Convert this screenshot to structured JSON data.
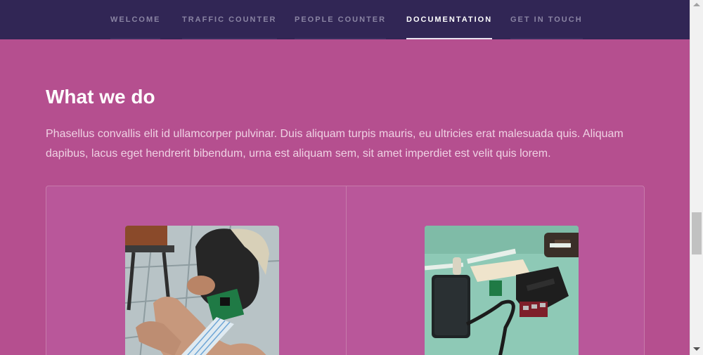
{
  "nav": {
    "items": [
      {
        "label": "WELCOME",
        "active": false
      },
      {
        "label": "TRAFFIC COUNTER",
        "active": false
      },
      {
        "label": "PEOPLE COUNTER",
        "active": false
      },
      {
        "label": "DOCUMENTATION",
        "active": true
      },
      {
        "label": "GET IN TOUCH",
        "active": false
      }
    ]
  },
  "section": {
    "title": "What we do",
    "intro": "Phasellus convallis elit id ullamcorper pulvinar. Duis aliquam turpis mauris, eu ultricies erat malesuada quis. Aliquam dapibus, lacus eget hendrerit bibendum, urna est aliquam sem, sit amet imperdiet est velit quis lorem."
  },
  "colors": {
    "nav_bg": "#312655",
    "page_bg": "#b54f8f",
    "active_nav": "#ffffff",
    "inactive_nav": "#8a84a3"
  }
}
